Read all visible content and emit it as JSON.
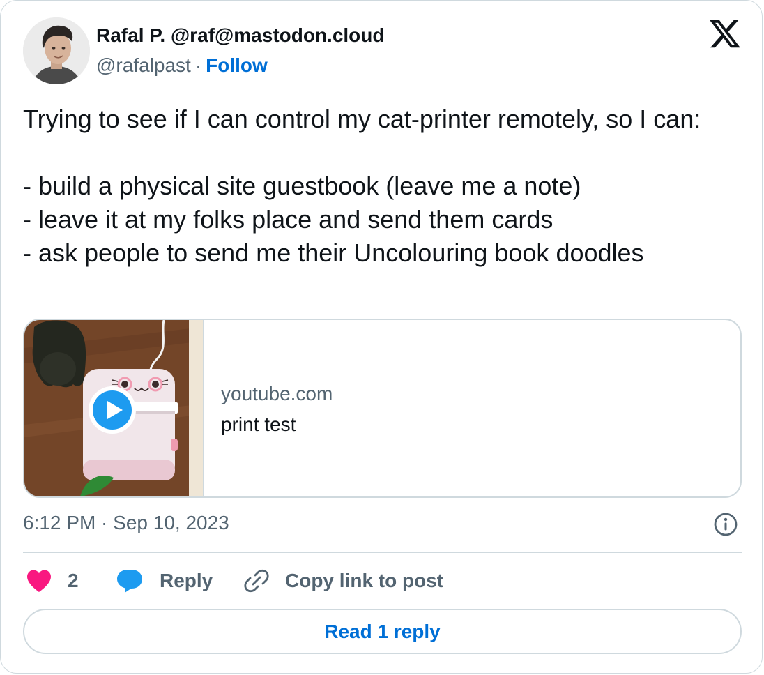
{
  "author": {
    "display_name": "Rafal P. @raf@mastodon.cloud",
    "handle": "@rafalpast",
    "separator": "·",
    "follow_label": "Follow"
  },
  "post": {
    "lines": [
      "Trying to see if I can control my cat-printer remotely, so I can:",
      "",
      "- build a physical site guestbook (leave me a note)",
      "- leave it at my folks place and send them cards",
      "- ask people to send me their Uncolouring book doodles"
    ]
  },
  "link_card": {
    "domain": "youtube.com",
    "title": "print test"
  },
  "timestamp": "6:12 PM · Sep 10, 2023",
  "actions": {
    "like_count": "2",
    "reply_label": "Reply",
    "copy_link_label": "Copy link to post"
  },
  "read_replies_label": "Read 1 reply",
  "icons": {
    "brand": "x-logo-icon",
    "info": "info-icon",
    "like": "heart-icon",
    "reply": "speech-bubble-icon",
    "copy": "link-icon",
    "play": "play-icon"
  },
  "colors": {
    "text_primary": "#0f1419",
    "text_secondary": "#536471",
    "link_blue": "#006fd6",
    "border": "#cfd9de",
    "like_pink": "#f91880",
    "reply_blue": "#1d9bf0"
  }
}
